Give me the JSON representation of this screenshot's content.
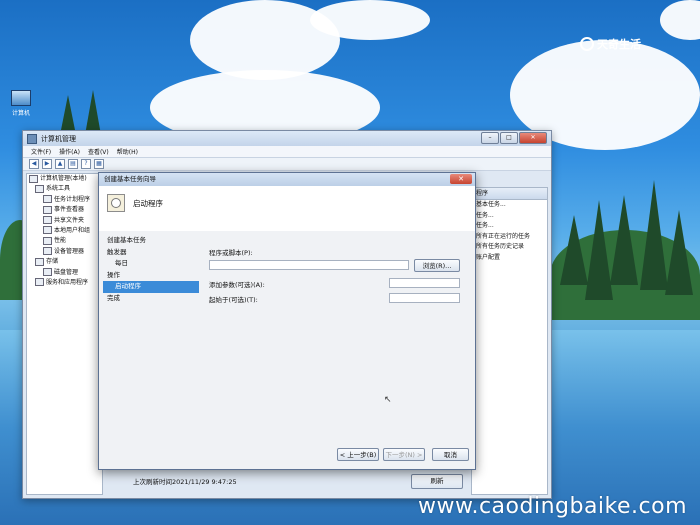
{
  "desktop": {
    "icon_label": "计算机",
    "logo_text": "天奇生活",
    "watermark": "www.caodingbaike.com"
  },
  "mmc": {
    "title": "计算机管理",
    "menu": [
      "文件(F)",
      "操作(A)",
      "查看(V)",
      "帮助(H)"
    ],
    "tree": [
      "计算机管理(本地)",
      "系统工具",
      "任务计划程序",
      "事件查看器",
      "共享文件夹",
      "本地用户和组",
      "性能",
      "设备管理器",
      "存储",
      "磁盘管理",
      "服务和应用程序"
    ],
    "actions_head": "程序",
    "actions": [
      "基本任务...",
      "任务...",
      "任务...",
      "所有正在运行的任务",
      "所有任务历史记录",
      "账户配置"
    ],
    "status": "上次刷新时间2021/11/29 9:47:25",
    "refresh_label": "刷新"
  },
  "wizard": {
    "title": "创建基本任务向导",
    "header_title": "启动程序",
    "steps": [
      {
        "label": "创建基本任务",
        "sub": false,
        "active": false
      },
      {
        "label": "触发器",
        "sub": false,
        "active": false
      },
      {
        "label": "每日",
        "sub": true,
        "active": false
      },
      {
        "label": "操作",
        "sub": false,
        "active": false
      },
      {
        "label": "启动程序",
        "sub": true,
        "active": true
      },
      {
        "label": "完成",
        "sub": false,
        "active": false
      }
    ],
    "program_label": "程序或脚本(P):",
    "program_value": "",
    "browse_label": "浏览(R)...",
    "args_label": "添加参数(可选)(A):",
    "args_value": "",
    "startin_label": "起始于(可选)(T):",
    "startin_value": "",
    "back_label": "< 上一步(B)",
    "next_label": "下一步(N) >",
    "cancel_label": "取消"
  }
}
